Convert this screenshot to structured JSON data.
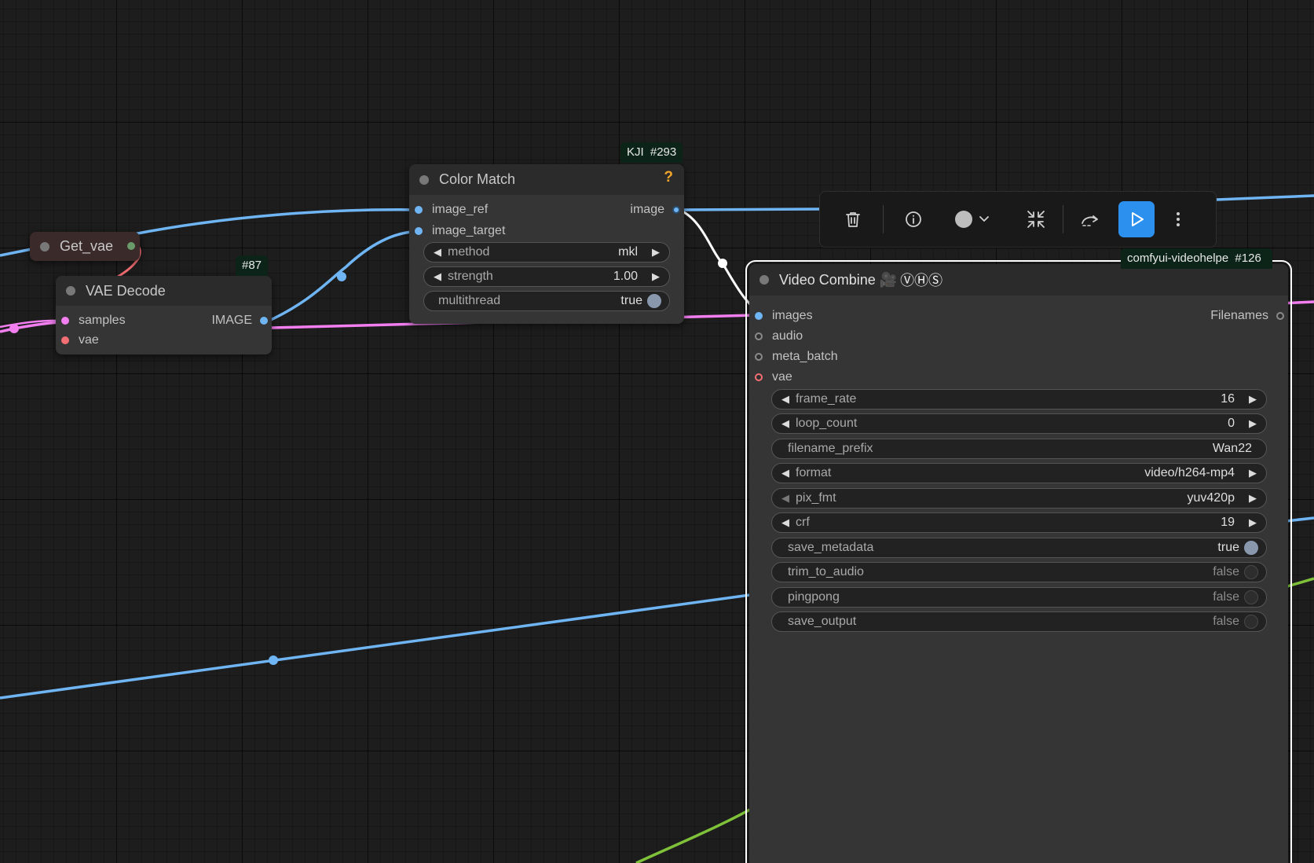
{
  "nodes": {
    "get_vae": {
      "title": "Get_vae"
    },
    "vae_decode": {
      "title": "VAE Decode",
      "badge": "#87",
      "inputs": [
        "samples",
        "vae"
      ],
      "output": "IMAGE"
    },
    "color_match": {
      "title": "Color Match",
      "badge_source": "KJI",
      "badge_id": "#293",
      "help_icon": "?",
      "inputs": [
        "image_ref",
        "image_target"
      ],
      "output": "image",
      "widgets": {
        "method": {
          "label": "method",
          "value": "mkl"
        },
        "strength": {
          "label": "strength",
          "value": "1.00"
        },
        "multithread": {
          "label": "multithread",
          "value": "true"
        }
      }
    },
    "video_combine": {
      "title": "Video Combine 🎥",
      "title_glyphs": "ⓋⒽⓈ",
      "badge_source": "comfyui-videohelpe",
      "badge_id": "#126",
      "inputs": [
        "images",
        "audio",
        "meta_batch",
        "vae"
      ],
      "output": "Filenames",
      "widgets": {
        "frame_rate": {
          "label": "frame_rate",
          "value": "16"
        },
        "loop_count": {
          "label": "loop_count",
          "value": "0"
        },
        "filename_prefix": {
          "label": "filename_prefix",
          "value": "Wan22"
        },
        "format": {
          "label": "format",
          "value": "video/h264-mp4"
        },
        "pix_fmt": {
          "label": "pix_fmt",
          "value": "yuv420p"
        },
        "crf": {
          "label": "crf",
          "value": "19"
        },
        "save_metadata": {
          "label": "save_metadata",
          "value": "true"
        },
        "trim_to_audio": {
          "label": "trim_to_audio",
          "value": "false"
        },
        "pingpong": {
          "label": "pingpong",
          "value": "false"
        },
        "save_output": {
          "label": "save_output",
          "value": "false"
        }
      }
    }
  },
  "toolbar": {
    "buttons": [
      "trash-icon",
      "info-icon",
      "color-picker-icon",
      "collapse-icon",
      "bypass-icon",
      "run-icon",
      "more-icon"
    ]
  },
  "colors": {
    "canvas_bg": "#1d1d1d",
    "node_bg": "#353535",
    "node_header": "#2b2b2b",
    "image_link": "#6fb5f4",
    "latent_link": "#f27ef0",
    "vae_link": "#f36f74",
    "green_link": "#7fc23a",
    "run_button": "#2c90ee",
    "badge_bg": "#0c2418"
  }
}
